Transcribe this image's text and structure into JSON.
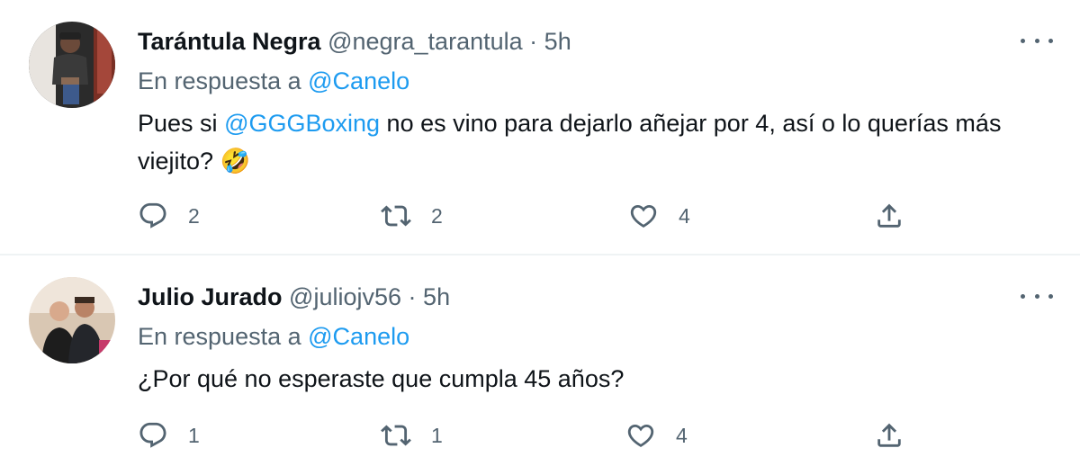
{
  "tweets": [
    {
      "name": "Tarántula Negra",
      "handle": "@negra_tarantula",
      "separator": "·",
      "time": "5h",
      "reply_prefix": "En respuesta a",
      "reply_to": "@Canelo",
      "text_before": "Pues si",
      "text_mention": "@GGGBoxing",
      "text_after": "no es vino para dejarlo añejar por 4, así o lo querías más viejito?",
      "emoji": "🤣",
      "replies": "2",
      "retweets": "2",
      "likes": "4"
    },
    {
      "name": "Julio Jurado",
      "handle": "@juliojv56",
      "separator": "·",
      "time": "5h",
      "reply_prefix": "En respuesta a",
      "reply_to": "@Canelo",
      "text": "¿Por qué no esperaste que cumpla 45 años?",
      "replies": "1",
      "retweets": "1",
      "likes": "4"
    }
  ],
  "colors": {
    "link": "#1d9bf0",
    "secondary": "#536471",
    "primary": "#0f1419",
    "divider": "#eff3f4"
  },
  "icons": [
    "reply-icon",
    "retweet-icon",
    "like-icon",
    "share-icon",
    "more-icon"
  ]
}
